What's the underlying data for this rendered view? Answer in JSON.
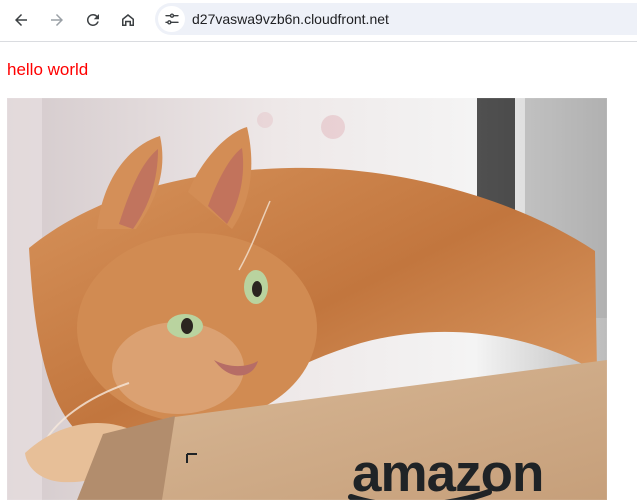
{
  "browser": {
    "url": "d27vaswa9vzb6n.cloudfront.net",
    "icons": {
      "back": "back-arrow-icon",
      "forward": "forward-arrow-icon",
      "reload": "reload-icon",
      "home": "home-icon",
      "site_info": "tune-icon"
    }
  },
  "page": {
    "greeting": "hello world",
    "greeting_color": "#ff0000"
  },
  "photo": {
    "box_text": "amazon"
  },
  "colors": {
    "toolbar_bg": "#ffffff",
    "address_bar_bg": "#eef1f8",
    "icon": "#3c4043",
    "disabled_icon": "#9aa0a6"
  }
}
